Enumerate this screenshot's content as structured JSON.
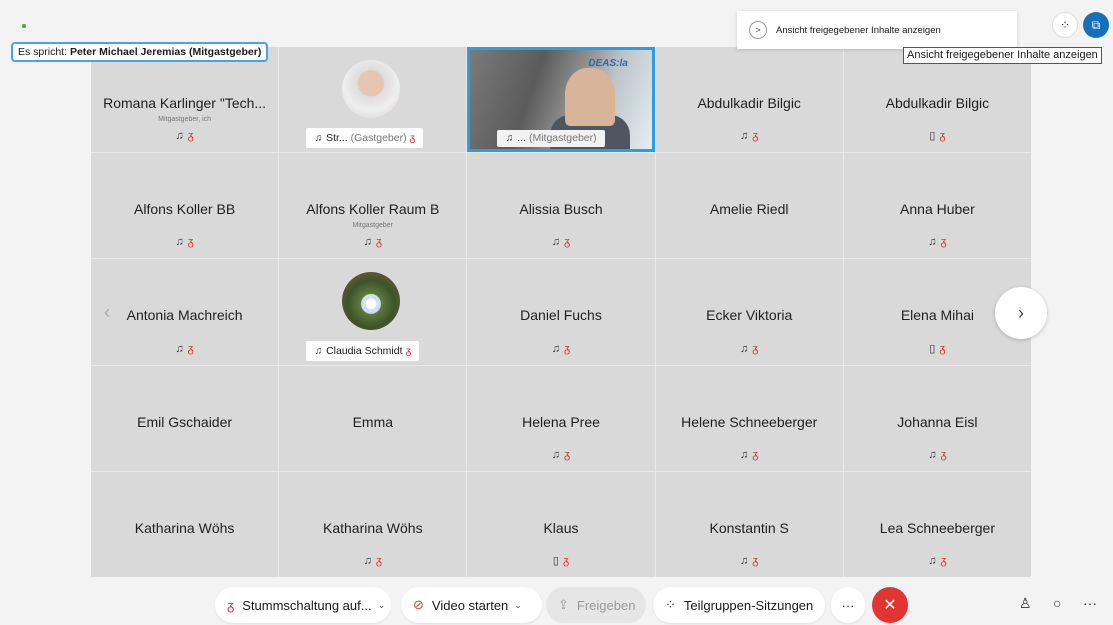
{
  "speaker": {
    "prefix": "Es spricht:",
    "name": "Peter Michael Jeremias (Mitgastgeber)"
  },
  "share_panel": {
    "label": "Ansicht freigegebener Inhalte anzeigen",
    "arrow": ">"
  },
  "tooltip": "Ansicht freigegebener Inhalte anzeigen",
  "top_right": {
    "grid_icon": "⁘",
    "share_icon": "⧉"
  },
  "nav": {
    "prev": "‹",
    "next": "›"
  },
  "tiles": [
    {
      "name": "Romana Karlinger \"Tech...",
      "sub": "Mitgastgeber, ich",
      "icons": "phone-mic"
    },
    {
      "avatar": "man",
      "pill": "Str...",
      "pill_muted": "(Gastgeber)"
    },
    {
      "video": true,
      "poster": "DEAS:la",
      "pill": "...",
      "pill_muted": "(Mitgastgeber)"
    },
    {
      "name": "Abdulkadir Bilgic",
      "icons": "phone-mic"
    },
    {
      "name": "Abdulkadir Bilgic",
      "icons": "mobile-mic"
    },
    {
      "name": "Alfons Koller BB",
      "icons": "phone-mic"
    },
    {
      "name": "Alfons Koller Raum B",
      "sub": "Mitgastgeber",
      "icons": "phone-mic"
    },
    {
      "name": "Alissia Busch",
      "icons": "phone-mic"
    },
    {
      "name": "Amelie Riedl"
    },
    {
      "name": "Anna Huber",
      "icons": "phone-mic"
    },
    {
      "name": "Antonia Machreich",
      "icons": "phone-mic"
    },
    {
      "avatar": "flower",
      "pill": "Claudia Schmidt"
    },
    {
      "name": "Daniel Fuchs",
      "icons": "phone-mic"
    },
    {
      "name": "Ecker Viktoria",
      "icons": "phone-mic"
    },
    {
      "name": "Elena Mihai",
      "icons": "mobile-mic"
    },
    {
      "name": "Emil Gschaider"
    },
    {
      "name": "Emma"
    },
    {
      "name": "Helena Pree",
      "icons": "phone-mic"
    },
    {
      "name": "Helene Schneeberger",
      "icons": "phone-mic"
    },
    {
      "name": "Johanna Eisl",
      "icons": "phone-mic"
    },
    {
      "name": "Katharina Wöhs"
    },
    {
      "name": "Katharina Wöhs",
      "icons": "phone-mic"
    },
    {
      "name": "Klaus",
      "icons": "mobile-mic"
    },
    {
      "name": "Konstantin S",
      "icons": "phone-mic"
    },
    {
      "name": "Lea Schneeberger",
      "icons": "phone-mic"
    }
  ],
  "toolbar": {
    "mute": "Stummschaltung auf...",
    "video": "Video starten",
    "share": "Freigeben",
    "breakout": "Teilgruppen-Sitzungen",
    "more": "···",
    "end": "✕",
    "participants_icon": "♙",
    "chat_icon": "○",
    "more_right": "···"
  },
  "colors": {
    "accent": "#1670b8",
    "mute_red": "#e03333",
    "end_red": "#e33434",
    "speaker_border": "#46a3ef"
  }
}
